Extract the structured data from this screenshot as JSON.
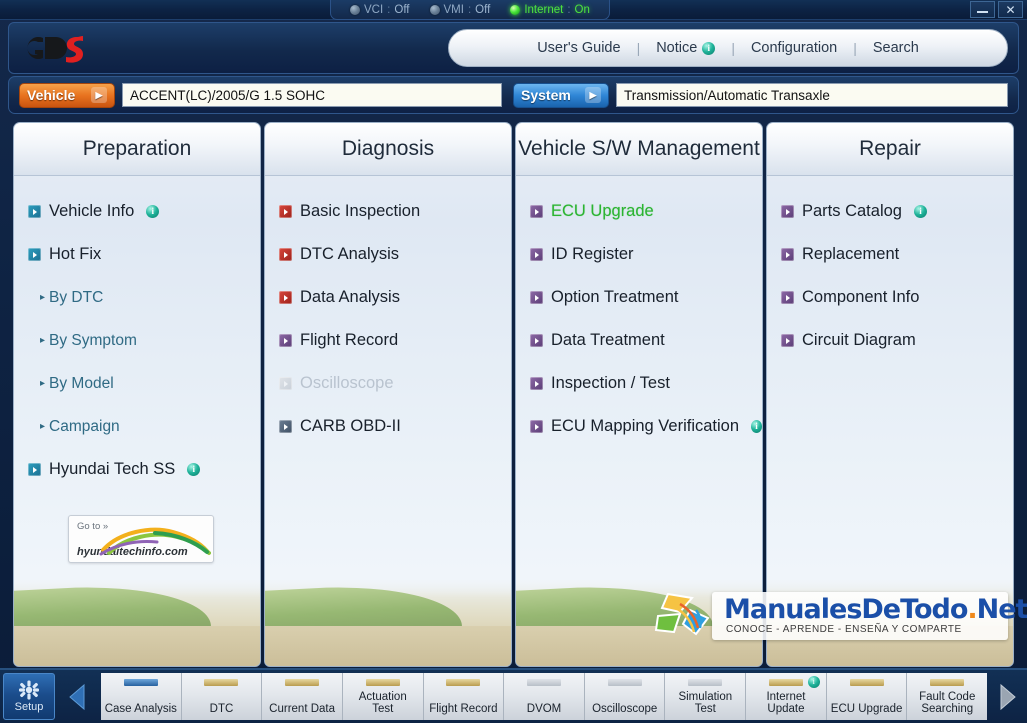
{
  "titlebar": {
    "status": [
      {
        "name": "VCI",
        "sep": ":",
        "value": "Off",
        "on": false
      },
      {
        "name": "VMI",
        "sep": ":",
        "value": "Off",
        "on": false
      },
      {
        "name": "Internet",
        "sep": ":",
        "value": "On",
        "on": true
      }
    ],
    "minimize_label": "",
    "close_label": "✕"
  },
  "header": {
    "logo_text": "GDS",
    "menu": [
      {
        "label": "User's Guide",
        "badge": null
      },
      {
        "label": "Notice",
        "badge": "i"
      },
      {
        "label": "Configuration",
        "badge": null
      },
      {
        "label": "Search",
        "badge": null
      }
    ],
    "separator": "|"
  },
  "vehicle_bar": {
    "vehicle_button": "Vehicle",
    "vehicle_value": "ACCENT(LC)/2005/G 1.5 SOHC",
    "system_button": "System",
    "system_value": "Transmission/Automatic Transaxle",
    "arrow_glyph": "▶"
  },
  "panels": [
    {
      "title": "Preparation",
      "items": [
        {
          "label": "Vehicle Info",
          "icon": "teal",
          "badge": "i",
          "type": "item"
        },
        {
          "label": "Hot Fix",
          "icon": "teal",
          "badge": null,
          "type": "item"
        },
        {
          "label": "By DTC",
          "icon": null,
          "badge": null,
          "type": "sub"
        },
        {
          "label": "By Symptom",
          "icon": null,
          "badge": null,
          "type": "sub"
        },
        {
          "label": "By Model",
          "icon": null,
          "badge": null,
          "type": "sub"
        },
        {
          "label": "Campaign",
          "icon": null,
          "badge": null,
          "type": "sub"
        },
        {
          "label": "Hyundai Tech SS",
          "icon": "teal",
          "badge": "i",
          "type": "item"
        }
      ],
      "promo": {
        "goto": "Go to »",
        "domain": "hyundaitechinfo.com"
      }
    },
    {
      "title": "Diagnosis",
      "items": [
        {
          "label": "Basic Inspection",
          "icon": "red",
          "badge": null,
          "type": "item"
        },
        {
          "label": "DTC Analysis",
          "icon": "red",
          "badge": null,
          "type": "item"
        },
        {
          "label": "Data Analysis",
          "icon": "red",
          "badge": null,
          "type": "item"
        },
        {
          "label": "Flight Record",
          "icon": "purp",
          "badge": null,
          "type": "item"
        },
        {
          "label": "Oscilloscope",
          "icon": "gray",
          "badge": null,
          "type": "disabled"
        },
        {
          "label": "CARB OBD-II",
          "icon": "slate",
          "badge": null,
          "type": "item"
        }
      ]
    },
    {
      "title": "Vehicle S/W Management",
      "items": [
        {
          "label": "ECU Upgrade",
          "icon": "purp",
          "badge": null,
          "type": "active"
        },
        {
          "label": "ID Register",
          "icon": "purp",
          "badge": null,
          "type": "item"
        },
        {
          "label": "Option Treatment",
          "icon": "purp",
          "badge": null,
          "type": "item"
        },
        {
          "label": "Data Treatment",
          "icon": "purp",
          "badge": null,
          "type": "item"
        },
        {
          "label": "Inspection / Test",
          "icon": "purp",
          "badge": null,
          "type": "item"
        },
        {
          "label": "ECU Mapping Verification",
          "icon": "purp",
          "badge": "i",
          "type": "item"
        }
      ]
    },
    {
      "title": "Repair",
      "items": [
        {
          "label": "Parts Catalog",
          "icon": "purp",
          "badge": "i",
          "type": "item"
        },
        {
          "label": "Replacement",
          "icon": "purp",
          "badge": null,
          "type": "item"
        },
        {
          "label": "Component Info",
          "icon": "purp",
          "badge": null,
          "type": "item"
        },
        {
          "label": "Circuit Diagram",
          "icon": "purp",
          "badge": null,
          "type": "item"
        }
      ]
    }
  ],
  "watermark": {
    "main_a": "ManualesDeTodo",
    "main_dot": ".",
    "main_b": "Net",
    "tagline": "CONOCE - APRENDE - ENSEÑA Y COMPARTE"
  },
  "toolbar": {
    "setup_label": "Setup",
    "prev_glyph": "◀",
    "next_glyph": "▶",
    "tabs": [
      {
        "label": "Case Analysis",
        "chip": "blue",
        "badge": null
      },
      {
        "label": "DTC",
        "chip": "tan",
        "badge": null
      },
      {
        "label": "Current Data",
        "chip": "tan",
        "badge": null
      },
      {
        "label": "Actuation\nTest",
        "chip": "tan",
        "badge": null
      },
      {
        "label": "Flight Record",
        "chip": "tan",
        "badge": null
      },
      {
        "label": "DVOM",
        "chip": "gray",
        "badge": null
      },
      {
        "label": "Oscilloscope",
        "chip": "gray",
        "badge": null
      },
      {
        "label": "Simulation\nTest",
        "chip": "gray",
        "badge": null
      },
      {
        "label": "Internet\nUpdate",
        "chip": "tan",
        "badge": "i"
      },
      {
        "label": "ECU Upgrade",
        "chip": "tan",
        "badge": null
      },
      {
        "label": "Fault Code\nSearching",
        "chip": "tan",
        "badge": null
      }
    ]
  },
  "colors": {
    "accent_blue": "#2f86d6",
    "accent_orange": "#e8731f",
    "active_green": "#2bb431",
    "info_teal": "#1fb39a",
    "panel_bg": "#e8eef6"
  }
}
